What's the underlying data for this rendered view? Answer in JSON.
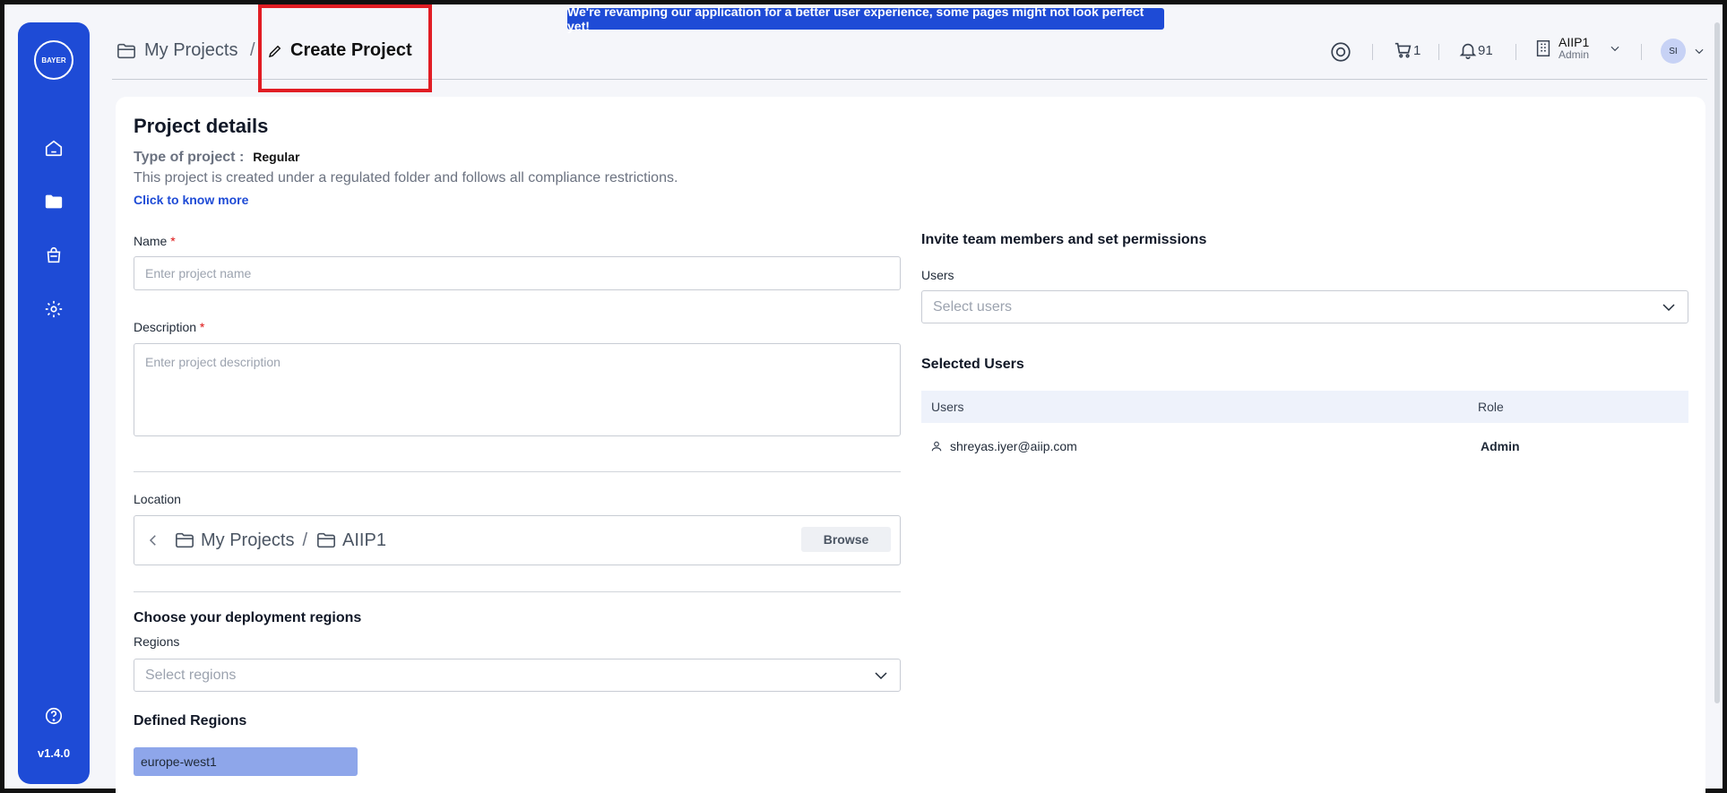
{
  "banner": {
    "text": "We're revamping our application for a better user experience, some pages might not look perfect yet!"
  },
  "sidebar": {
    "logo_text": "BAYER",
    "items": [
      {
        "name": "home",
        "icon": "home-icon"
      },
      {
        "name": "projects",
        "icon": "folder-icon"
      },
      {
        "name": "store",
        "icon": "bag-icon"
      },
      {
        "name": "settings",
        "icon": "gear-icon"
      }
    ],
    "help_icon": "help-icon",
    "version": "v1.4.0"
  },
  "header": {
    "breadcrumb": [
      {
        "label": "My Projects",
        "icon": "folder-icon"
      },
      {
        "label": "Create Project",
        "icon": "pencil-icon"
      }
    ],
    "separator": "/",
    "cart_count": "1",
    "notifications_count": "91",
    "org": {
      "name": "AIIP1",
      "role": "Admin"
    },
    "avatar_initials": "SI"
  },
  "form": {
    "title": "Project details",
    "type_label": "Type of project :",
    "type_value": "Regular",
    "description_note": "This project is created under a regulated folder and follows all compliance restrictions.",
    "know_more": "Click to know more",
    "name_label": "Name",
    "name_placeholder": "Enter project name",
    "description_label": "Description",
    "description_placeholder": "Enter project description",
    "required_mark": "*",
    "location_label": "Location",
    "location_path": [
      "My Projects",
      "AIIP1"
    ],
    "browse": "Browse",
    "regions_title": "Choose your deployment regions",
    "regions_label": "Regions",
    "regions_placeholder": "Select regions",
    "defined_regions_title": "Defined Regions",
    "defined_regions": [
      "europe-west1"
    ]
  },
  "team": {
    "title": "Invite team members and set permissions",
    "users_label": "Users",
    "users_placeholder": "Select users",
    "selected_title": "Selected Users",
    "columns": [
      "Users",
      "Role"
    ],
    "rows": [
      {
        "user": "shreyas.iyer@aiip.com",
        "role": "Admin"
      }
    ]
  }
}
